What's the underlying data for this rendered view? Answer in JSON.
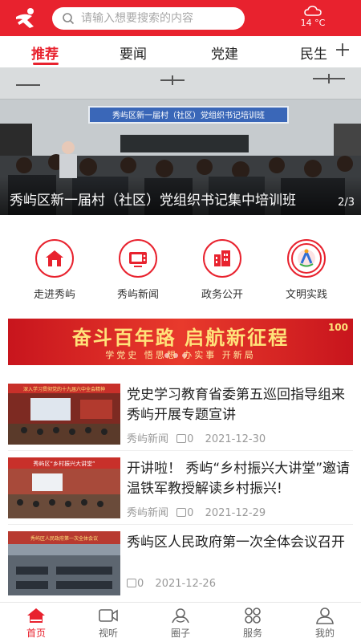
{
  "header": {
    "search_placeholder": "请输入想要搜索的内容",
    "weather_temp": "14 °C",
    "weather_icon": "cloudy-icon",
    "brand_color": "#e8222e"
  },
  "tabs": [
    {
      "label": "推荐",
      "active": true
    },
    {
      "label": "要闻",
      "active": false
    },
    {
      "label": "党建",
      "active": false
    },
    {
      "label": "民生",
      "active": false
    }
  ],
  "banner": {
    "title": "秀屿区新一届村（社区）党组织书记集中培训班",
    "page": "2/3",
    "sign_text": "秀屿区新一届村（社区）党组织书记培训班"
  },
  "quick_links": [
    {
      "label": "走进秀屿",
      "icon": "house-icon"
    },
    {
      "label": "秀屿新闻",
      "icon": "tv-icon"
    },
    {
      "label": "政务公开",
      "icon": "building-icon"
    },
    {
      "label": "文明实践",
      "icon": "civilization-badge-icon"
    }
  ],
  "slogan": {
    "title": "奋斗百年路  启航新征程",
    "subtitle": "学党史 悟思想 办实事 开新局",
    "badge": "100"
  },
  "news": [
    {
      "title": "党史学习教育省委第五巡回指导组来秀屿开展专题宣讲",
      "source": "秀屿新闻",
      "comments": "0",
      "date": "2021-12-30",
      "thumb_caption": "深入学习贯彻党的十九届六中全会精神"
    },
    {
      "title": "开讲啦！ 秀屿“乡村振兴大讲堂”邀请温铁军教授解读乡村振兴!",
      "source": "秀屿新闻",
      "comments": "0",
      "date": "2021-12-29",
      "thumb_caption": "秀屿区“乡村振兴大讲堂”"
    },
    {
      "title": "秀屿区人民政府第一次全体会议召开",
      "source": "",
      "comments": "0",
      "date": "2021-12-26",
      "thumb_caption": "秀屿区人民政府第一次全体会议"
    }
  ],
  "bottom_nav": [
    {
      "label": "首页",
      "icon": "home-icon",
      "active": true
    },
    {
      "label": "视听",
      "icon": "video-icon",
      "active": false
    },
    {
      "label": "圈子",
      "icon": "circle-icon",
      "active": false
    },
    {
      "label": "服务",
      "icon": "grid-icon",
      "active": false
    },
    {
      "label": "我的",
      "icon": "user-icon",
      "active": false
    }
  ]
}
